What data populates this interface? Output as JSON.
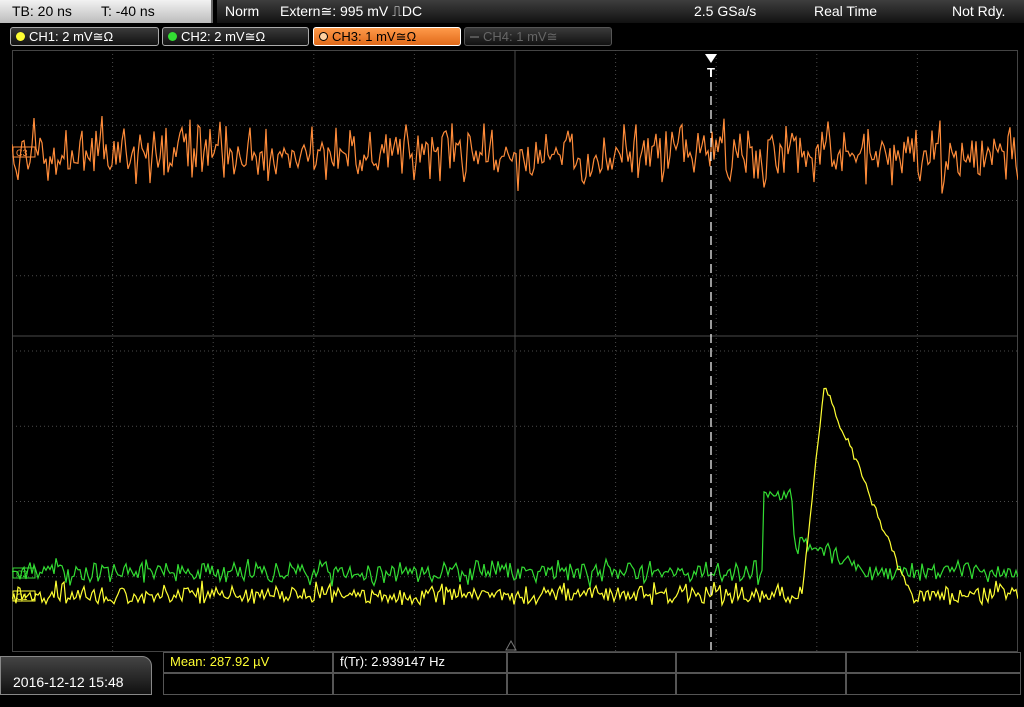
{
  "topbar": {
    "timebase": "TB: 20 ns",
    "trigger_time": "T: -40 ns",
    "mode": "Norm",
    "trigger_source": "Extern≅: 995 mV ⎍DC",
    "sample_rate": "2.5 GSa/s",
    "acq_mode": "Real Time",
    "status": "Not Rdy."
  },
  "channels": [
    {
      "label": "CH1: 2 mV≅Ω",
      "color": "#ffff33",
      "active": true
    },
    {
      "label": "CH2: 2 mV≅Ω",
      "color": "#33dd33",
      "active": true
    },
    {
      "label": "CH3: 1 mV≅Ω",
      "color": "#ff8c3a",
      "active": true,
      "selected": true
    },
    {
      "label": "CH4: 1 mV≅",
      "color": "#666666",
      "active": false
    }
  ],
  "screen": {
    "trigger_marker": "T",
    "ch3_marker": "C3",
    "ch2_marker": "C2",
    "ch1_marker": "C1"
  },
  "footer": {
    "datetime": "2016-12-12 15:48",
    "mean": "Mean: 287.92 µV",
    "freq": "f(Tr): 2.939147 Hz"
  },
  "colors": {
    "ch1": "#ffff33",
    "ch2": "#33dd33",
    "ch3": "#ff8c3a",
    "grid": "#4a4a4a",
    "trigger_line": "#ffffff"
  }
}
